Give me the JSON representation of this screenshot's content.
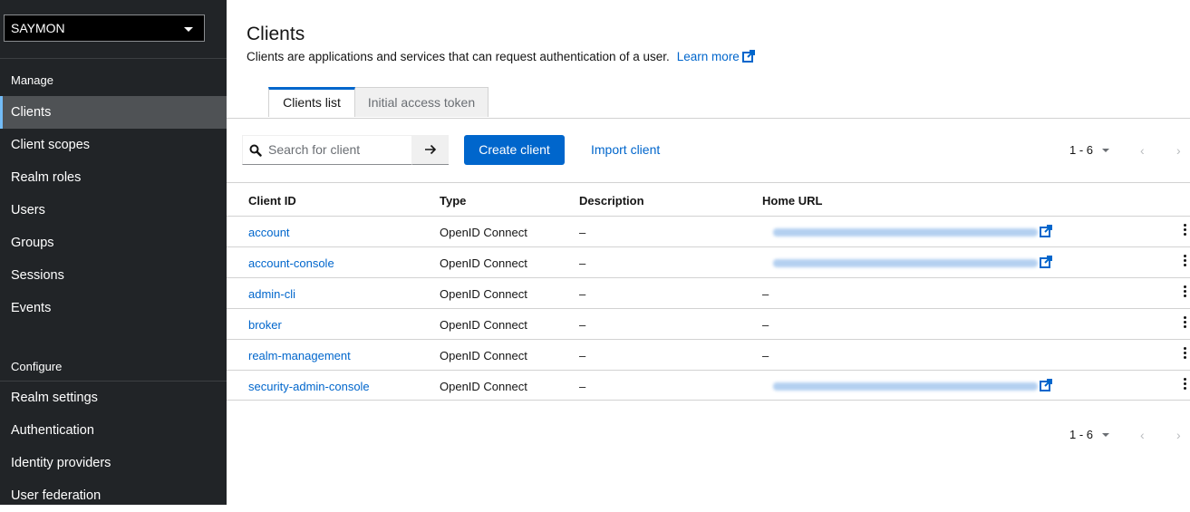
{
  "realm_selector": {
    "label": "SAYMON"
  },
  "sidebar": {
    "manage_section": "Manage",
    "manage_items": [
      {
        "label": "Clients",
        "active": true
      },
      {
        "label": "Client scopes"
      },
      {
        "label": "Realm roles"
      },
      {
        "label": "Users"
      },
      {
        "label": "Groups"
      },
      {
        "label": "Sessions"
      },
      {
        "label": "Events"
      }
    ],
    "configure_section": "Configure",
    "configure_items": [
      {
        "label": "Realm settings"
      },
      {
        "label": "Authentication"
      },
      {
        "label": "Identity providers"
      },
      {
        "label": "User federation"
      }
    ]
  },
  "page": {
    "title": "Clients",
    "description": "Clients are applications and services that can request authentication of a user.",
    "learn_more": "Learn more"
  },
  "tabs": [
    {
      "label": "Clients list",
      "active": true
    },
    {
      "label": "Initial access token"
    }
  ],
  "toolbar": {
    "search_placeholder": "Search for client",
    "create_button": "Create client",
    "import_link": "Import client"
  },
  "pagination": {
    "range": "1 - 6"
  },
  "table": {
    "headers": [
      "Client ID",
      "Type",
      "Description",
      "Home URL"
    ],
    "rows": [
      {
        "client_id": "account",
        "type": "OpenID Connect",
        "description": "–",
        "home_url_blurred": true
      },
      {
        "client_id": "account-console",
        "type": "OpenID Connect",
        "description": "–",
        "home_url_blurred": true
      },
      {
        "client_id": "admin-cli",
        "type": "OpenID Connect",
        "description": "–",
        "home_url": "–"
      },
      {
        "client_id": "broker",
        "type": "OpenID Connect",
        "description": "–",
        "home_url": "–"
      },
      {
        "client_id": "realm-management",
        "type": "OpenID Connect",
        "description": "–",
        "home_url": "–"
      },
      {
        "client_id": "security-admin-console",
        "type": "OpenID Connect",
        "description": "–",
        "home_url_blurred": true
      }
    ]
  },
  "colors": {
    "sidebar_bg": "#212427",
    "active_nav_bg": "#4f5255",
    "accent": "#0066cc",
    "link": "#0066cc"
  },
  "icons": [
    "chevron-down-icon",
    "external-link-icon",
    "search-icon",
    "arrow-right-icon",
    "kebab-icon",
    "angle-left-icon",
    "angle-right-icon"
  ]
}
